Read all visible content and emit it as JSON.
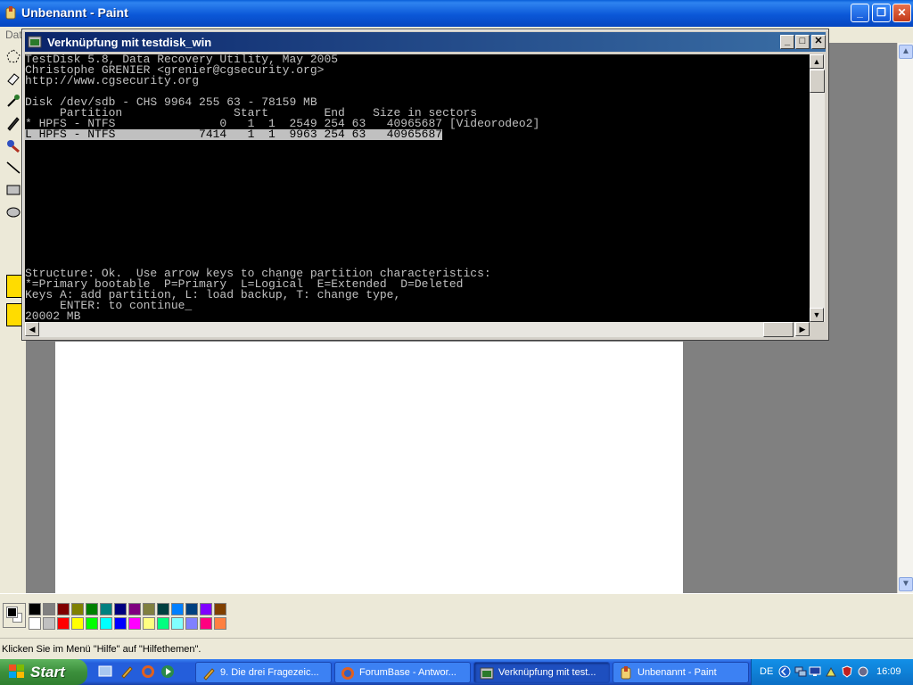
{
  "paint": {
    "title": "Unbenannt - Paint",
    "menu_fragment": "Dat",
    "status_text": "Klicken Sie im Menü \"Hilfe\" auf \"Hilfethemen\".",
    "palette": [
      "#000000",
      "#808080",
      "#800000",
      "#808000",
      "#008000",
      "#008080",
      "#000080",
      "#800080",
      "#808040",
      "#004040",
      "#0080ff",
      "#004080",
      "#8000ff",
      "#804000",
      "#ffffff",
      "#c0c0c0",
      "#ff0000",
      "#ffff00",
      "#00ff00",
      "#00ffff",
      "#0000ff",
      "#ff00ff",
      "#ffff80",
      "#00ff80",
      "#80ffff",
      "#8080ff",
      "#ff0080",
      "#ff8040"
    ]
  },
  "console": {
    "title": "Verknüpfung mit testdisk_win",
    "lines": [
      "TestDisk 5.8, Data Recovery Utility, May 2005",
      "Christophe GRENIER <grenier@cgsecurity.org>",
      "http://www.cgsecurity.org",
      "",
      "Disk /dev/sdb - CHS 9964 255 63 - 78159 MB",
      "     Partition                Start        End    Size in sectors",
      "* HPFS - NTFS               0   1  1  2549 254 63   40965687 [Videorodeo2]",
      "L HPFS - NTFS            7414   1  1  9963 254 63   40965687",
      "",
      "",
      "",
      "",
      "",
      "",
      "",
      "",
      "",
      "",
      "",
      "",
      "Structure: Ok.  Use arrow keys to change partition characteristics:",
      "*=Primary bootable  P=Primary  L=Logical  E=Extended  D=Deleted",
      "Keys A: add partition, L: load backup, T: change type,",
      "     ENTER: to continue_",
      "20002 MB"
    ]
  },
  "taskbar": {
    "start_label": "Start",
    "tasks": [
      {
        "label": "9. Die drei Fragezeic...",
        "icon": "paint-brush-icon",
        "active": false
      },
      {
        "label": "ForumBase - Antwor...",
        "icon": "firefox-icon",
        "active": false
      },
      {
        "label": "Verknüpfung mit test...",
        "icon": "console-icon",
        "active": true
      },
      {
        "label": "Unbenannt - Paint",
        "icon": "paint-icon",
        "active": false
      }
    ],
    "language": "DE",
    "clock": "16:09"
  }
}
